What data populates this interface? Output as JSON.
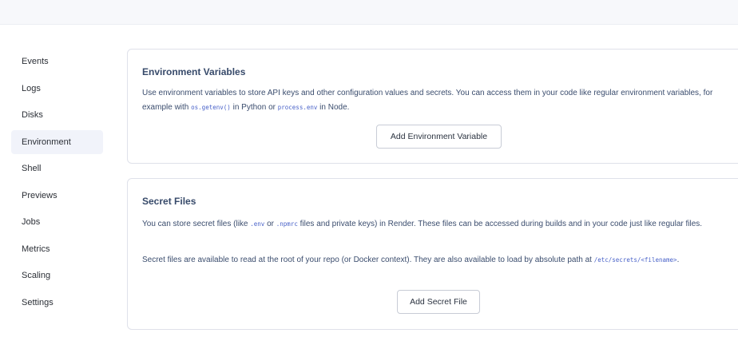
{
  "sidebar": {
    "items": [
      {
        "label": "Events"
      },
      {
        "label": "Logs"
      },
      {
        "label": "Disks"
      },
      {
        "label": "Environment",
        "active": true
      },
      {
        "label": "Shell"
      },
      {
        "label": "Previews"
      },
      {
        "label": "Jobs"
      },
      {
        "label": "Metrics"
      },
      {
        "label": "Scaling"
      },
      {
        "label": "Settings"
      }
    ]
  },
  "env_vars": {
    "title": "Environment Variables",
    "desc_part1": "Use environment variables to store API keys and other configuration values and secrets. You can access them in your code like regular environment variables, for example with ",
    "code1": "os.getenv()",
    "desc_part2": " in Python or ",
    "code2": "process.env",
    "desc_part3": " in Node.",
    "button_label": "Add Environment Variable"
  },
  "secret_files": {
    "title": "Secret Files",
    "p1_part1": "You can store secret files (like ",
    "p1_code1": ".env",
    "p1_part2": " or ",
    "p1_code2": ".npmrc",
    "p1_part3": " files and private keys) in Render. These files can be accessed during builds and in your code just like regular files.",
    "p2_part1": "Secret files are available to read at the root of your repo (or Docker context). They are also available to load by absolute path at ",
    "p2_code": "/etc/secrets/<filename>",
    "p2_part2": ".",
    "button_label": "Add Secret File"
  }
}
